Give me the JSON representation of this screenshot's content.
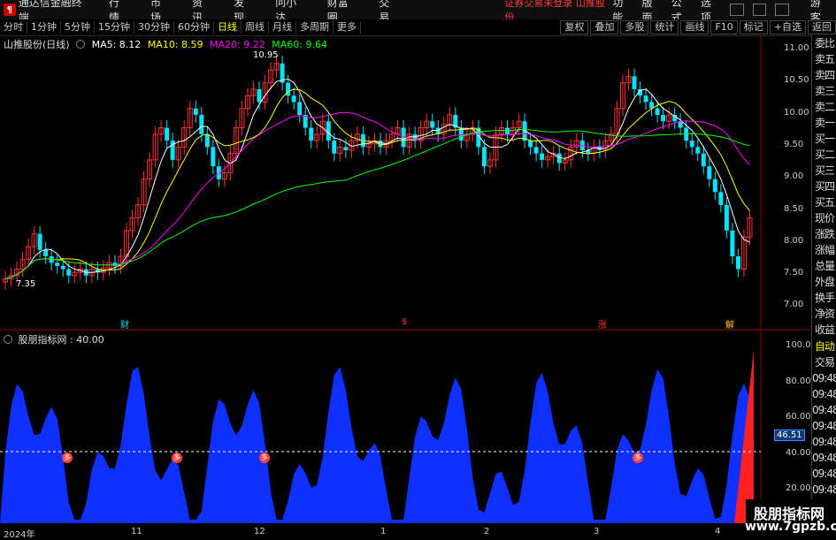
{
  "app": {
    "title": "通达信金融终端"
  },
  "menu": [
    "行情",
    "市场",
    "资讯",
    "发现",
    "问小达",
    "财富圈",
    "交易"
  ],
  "notice": "证券交易未登录  山推股份",
  "right_menu": [
    "功能",
    "版面",
    "公式",
    "选项"
  ],
  "guest": "游客",
  "periods": [
    "分时",
    "1分钟",
    "5分钟",
    "15分钟",
    "30分钟",
    "60分钟",
    "日线",
    "周线",
    "月线",
    "多周期",
    "更多"
  ],
  "active_period": "日线",
  "tools": [
    "复权",
    "叠加",
    "多股",
    "统计",
    "画线",
    "F10",
    "标记",
    "+自选",
    "返回"
  ],
  "sidebar": [
    "委比",
    "卖五",
    "卖四",
    "卖三",
    "卖二",
    "卖一",
    "买一",
    "买二",
    "买三",
    "买四",
    "买五",
    "现价",
    "涨跌",
    "涨幅",
    "总量",
    "外盘",
    "换手",
    "净资",
    "收益"
  ],
  "sidebar_lower": [
    "自动",
    "交易",
    "09:48",
    "09:48",
    "09:48",
    "09:48",
    "09:48",
    "09:48",
    "09:48",
    "09:48"
  ],
  "stock_title": "山推股份(日线)",
  "ma": {
    "ma5": "MA5: 8.12",
    "ma10": "MA10: 8.59",
    "ma20": "MA20: 9.22",
    "ma60": "MA60: 9.64"
  },
  "colors": {
    "ma5": "#ffffff",
    "ma10": "#ffff00",
    "ma20": "#ff00ff",
    "ma60": "#00ff00",
    "up": "#ff3333",
    "down": "#00e5ff",
    "blue": "#1030ff"
  },
  "price_axis": [
    "11.00",
    "10.50",
    "10.00",
    "9.50",
    "9.00",
    "8.50",
    "8.00",
    "7.50",
    "7.00"
  ],
  "high_label": "10.95",
  "low_label": "7.35",
  "indicator": {
    "title": "股朋指标网 : 40.00",
    "axis": [
      "100.0",
      "80.00",
      "60.00",
      "40.00",
      "20.00"
    ],
    "current": "46.51"
  },
  "markers": {
    "cai": "财",
    "dollar": "$",
    "zhang": "涨",
    "die": "跌",
    "yue": "解"
  },
  "badge": "多",
  "dates": [
    "2024年",
    "11",
    "12",
    "1",
    "2",
    "3",
    "4"
  ],
  "watermark": {
    "line1": "股朋指标网",
    "line2": "www.7gpzb.com"
  },
  "chart_data": {
    "type": "candlestick",
    "title": "山推股份(日线)",
    "ylim": [
      6.8,
      11.2
    ],
    "high": 10.95,
    "low": 7.35,
    "closes": [
      7.55,
      7.6,
      7.7,
      7.85,
      8.05,
      8.25,
      8.0,
      7.9,
      7.8,
      7.75,
      7.7,
      7.6,
      7.65,
      7.7,
      7.6,
      7.7,
      7.65,
      7.72,
      7.8,
      7.75,
      7.9,
      8.3,
      8.5,
      8.7,
      9.1,
      9.4,
      9.8,
      9.9,
      9.7,
      9.4,
      9.6,
      9.9,
      10.2,
      10.1,
      9.8,
      9.6,
      9.3,
      9.1,
      9.2,
      9.5,
      9.9,
      10.2,
      10.4,
      10.5,
      10.3,
      10.6,
      10.8,
      10.9,
      10.6,
      10.4,
      10.3,
      10.1,
      9.9,
      9.7,
      9.8,
      10.0,
      9.7,
      9.5,
      9.6,
      9.55,
      9.7,
      9.8,
      9.6,
      9.65,
      9.7,
      9.6,
      9.7,
      9.8,
      9.9,
      9.6,
      9.8,
      9.7,
      9.9,
      10.0,
      9.9,
      9.8,
      9.95,
      10.1,
      9.9,
      9.7,
      9.8,
      9.9,
      9.6,
      9.3,
      9.4,
      9.8,
      9.9,
      9.8,
      9.9,
      10.0,
      9.7,
      9.6,
      9.5,
      9.4,
      9.45,
      9.5,
      9.35,
      9.4,
      9.6,
      9.7,
      9.55,
      9.5,
      9.6,
      9.55,
      9.7,
      9.8,
      10.2,
      10.6,
      10.7,
      10.5,
      10.4,
      10.3,
      10.2,
      10.1,
      10.0,
      10.1,
      10.0,
      9.9,
      9.7,
      9.6,
      9.5,
      9.3,
      9.1,
      8.9,
      8.7,
      8.3,
      7.9,
      7.7,
      8.2,
      8.5
    ],
    "ma5": "MA5: 8.12",
    "indicator_current": 46.51
  }
}
